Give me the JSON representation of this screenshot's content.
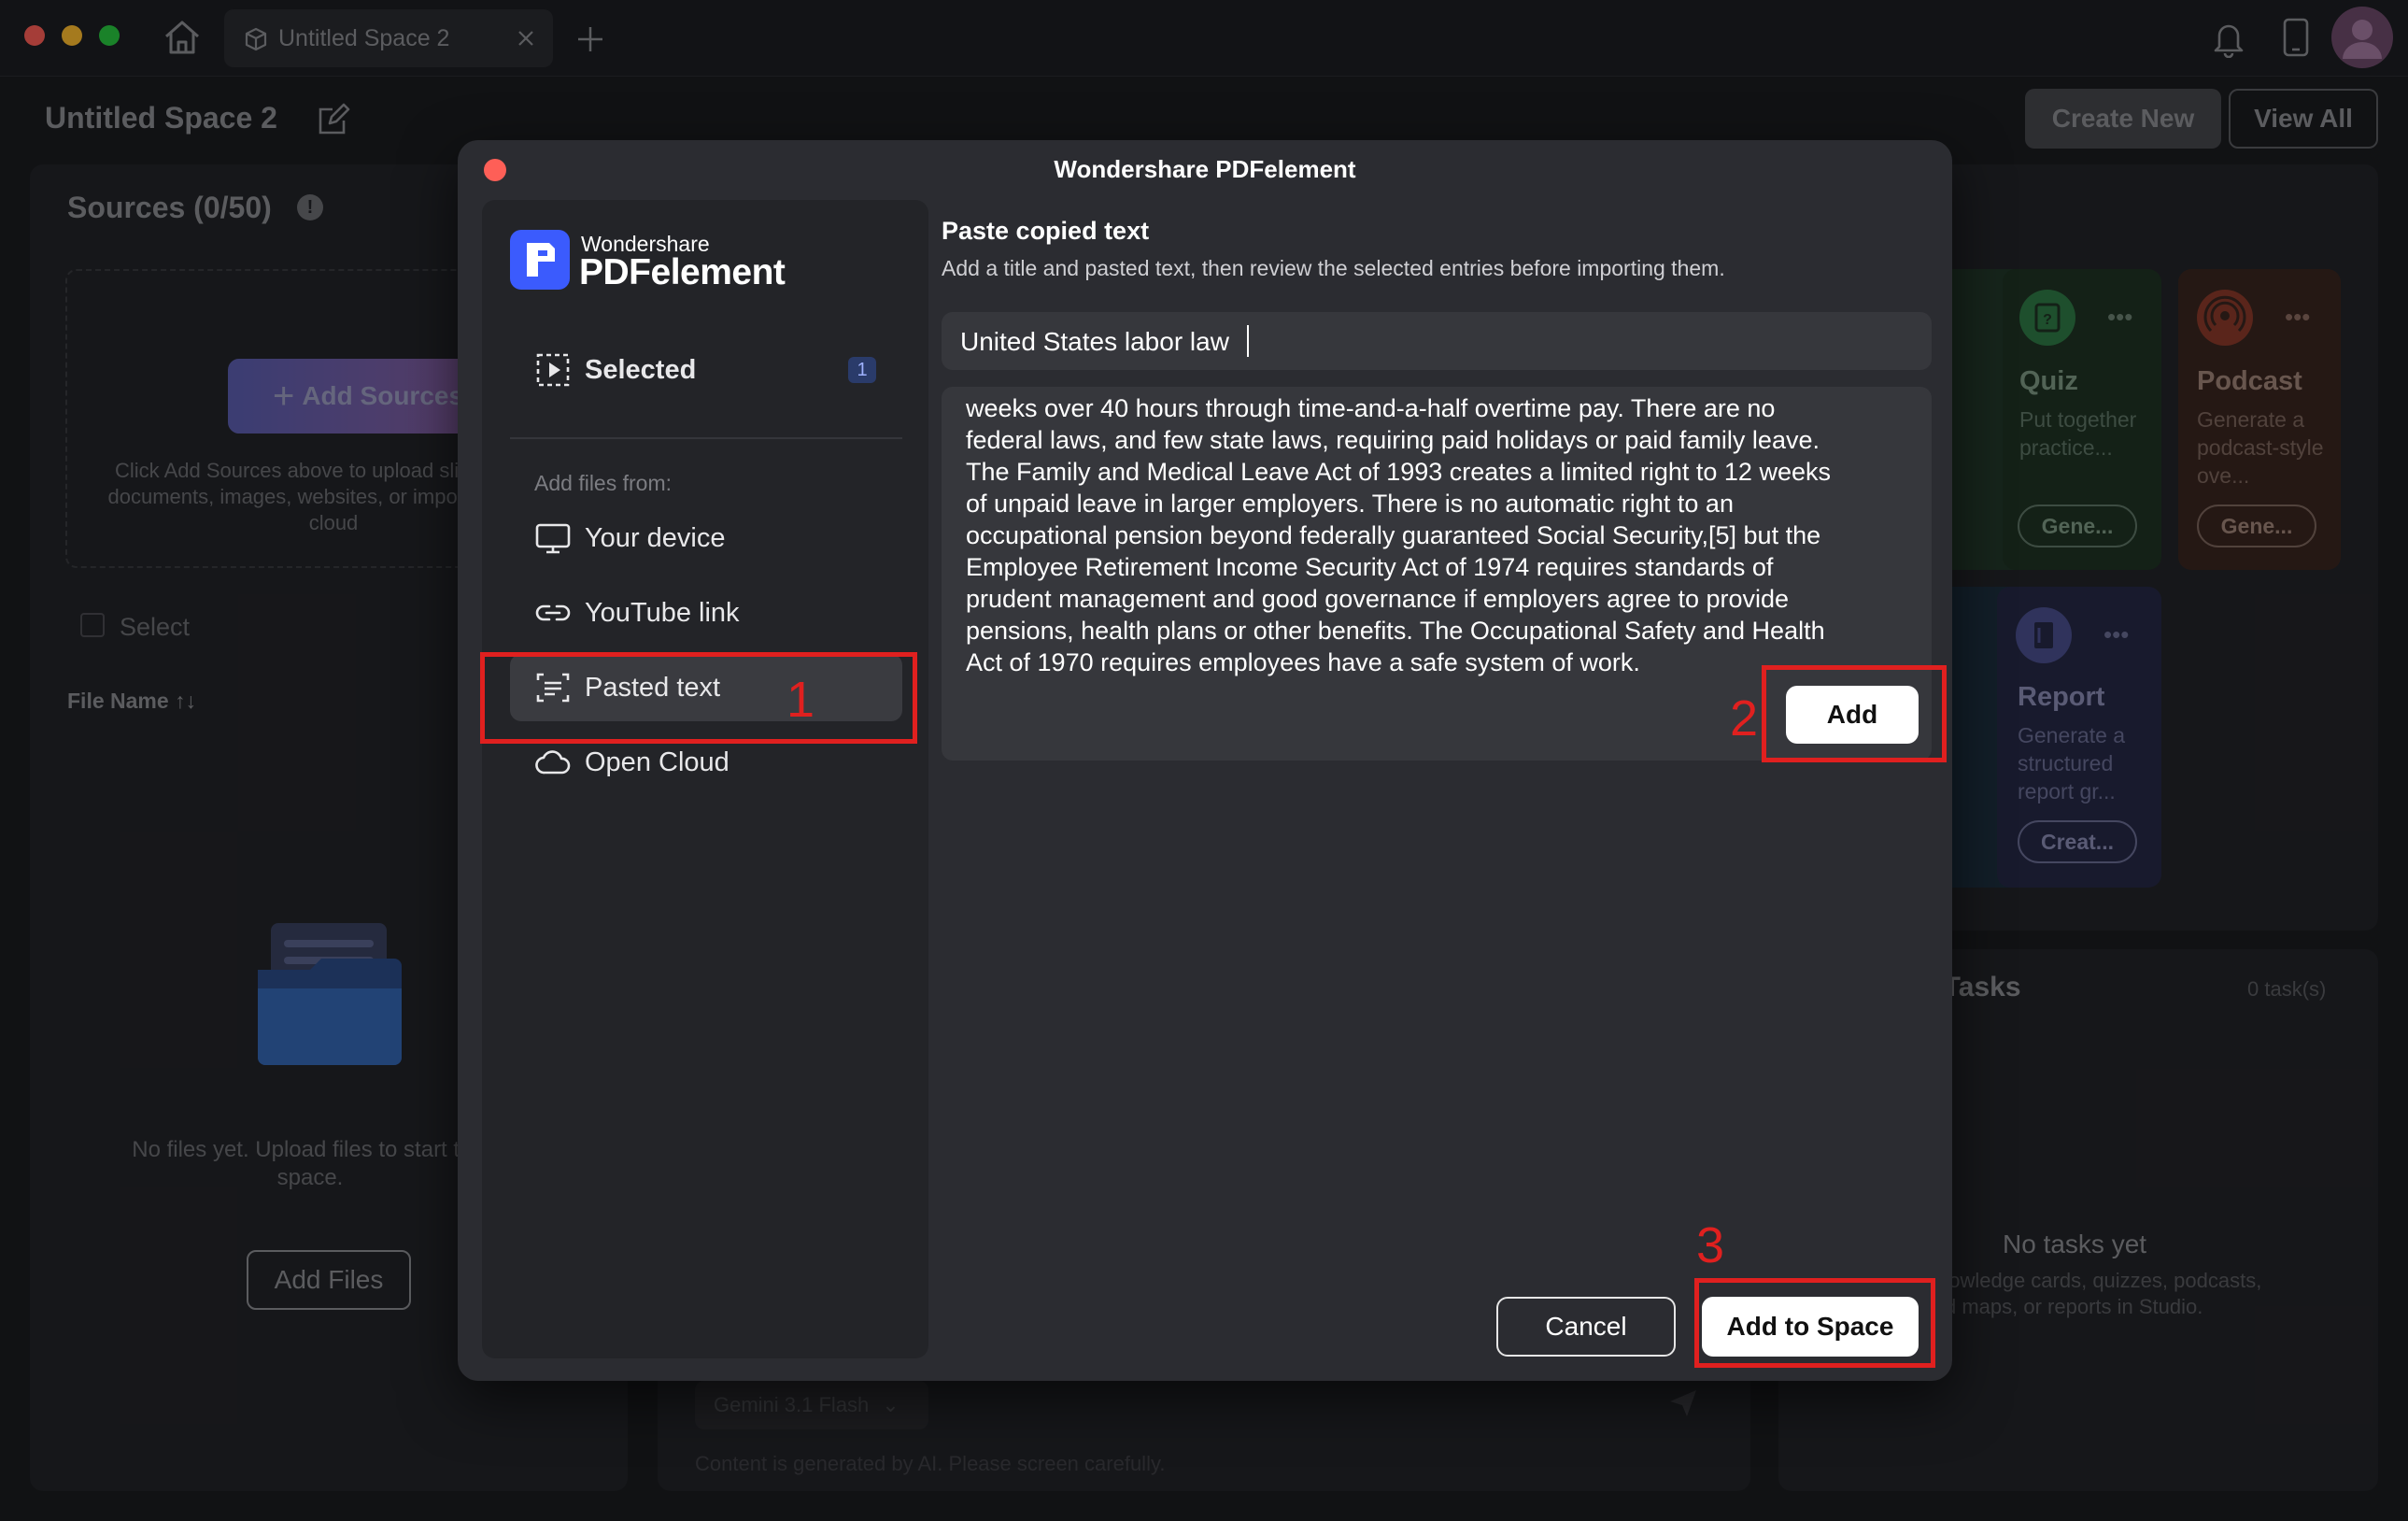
{
  "window": {
    "tab_title": "Untitled Space 2"
  },
  "header": {
    "space_title": "Untitled Space 2",
    "create_new_label": "Create New",
    "view_all_label": "View All"
  },
  "sources": {
    "title": "Sources (0/50)",
    "add_sources_label": "Add Sources",
    "drop_hint": "Click Add Sources above to upload slides, Word documents, images, websites, or import files from cloud",
    "select_label": "Select",
    "file_name_header": "File Name",
    "sort_glyph": "↑↓",
    "empty_text": "No files yet. Upload files to start this space.",
    "add_files_label": "Add Files"
  },
  "studio": {
    "cards": [
      {
        "title": "Quiz",
        "desc": "Put together practice...",
        "button": "Gene..."
      },
      {
        "title": "Podcast",
        "desc": "Generate a podcast-style ove...",
        "button": "Gene..."
      },
      {
        "title": "Report",
        "desc": "Generate a structured report gr...",
        "button": "Creat..."
      }
    ],
    "tasks_title": "d Tasks",
    "tasks_count": "0 task(s)",
    "no_tasks": "No tasks yet",
    "no_tasks_hint_1": "nowledge cards, quizzes, podcasts,",
    "no_tasks_hint_2": "d maps, or reports in Studio."
  },
  "chat": {
    "model": "Gemini 3.1 Flash",
    "disclaimer": "Content is generated by AI. Please screen carefully."
  },
  "modal": {
    "title": "Wondershare PDFelement",
    "brand_top": "Wondershare",
    "brand_main": "PDFelement",
    "selected_label": "Selected",
    "selected_count": "1",
    "add_files_from": "Add files from:",
    "menu": [
      {
        "label": "Your device",
        "icon": "monitor-icon"
      },
      {
        "label": "YouTube link",
        "icon": "link-icon"
      },
      {
        "label": "Pasted text",
        "icon": "paste-text-icon"
      },
      {
        "label": "Open Cloud",
        "icon": "cloud-icon"
      }
    ],
    "section_title": "Paste copied text",
    "section_subtitle": "Add a title and pasted text, then review the selected entries before importing them.",
    "title_input_value": "United States labor law",
    "text_lines": [
      "weeks over 40 hours through time-and-a-half overtime pay. There are no",
      "federal laws, and few state laws, requiring paid holidays or paid family leave.",
      "The Family and Medical Leave Act of 1993 creates a limited right to 12 weeks",
      "of unpaid leave in larger employers. There is no automatic right to an",
      "occupational pension beyond federally guaranteed Social Security,[5] but the",
      "Employee Retirement Income Security Act of 1974 requires standards of",
      "prudent management and good governance if employers agree to provide",
      "pensions, health plans or other benefits. The Occupational Safety and Health",
      "Act of 1970 requires employees have a safe system of work."
    ],
    "add_label": "Add",
    "cancel_label": "Cancel",
    "add_to_space_label": "Add to Space"
  },
  "annotations": {
    "step1": "1",
    "step2": "2",
    "step3": "3"
  },
  "colors": {
    "accent_red": "#e0201f",
    "brand_blue": "#3b5bfd"
  }
}
